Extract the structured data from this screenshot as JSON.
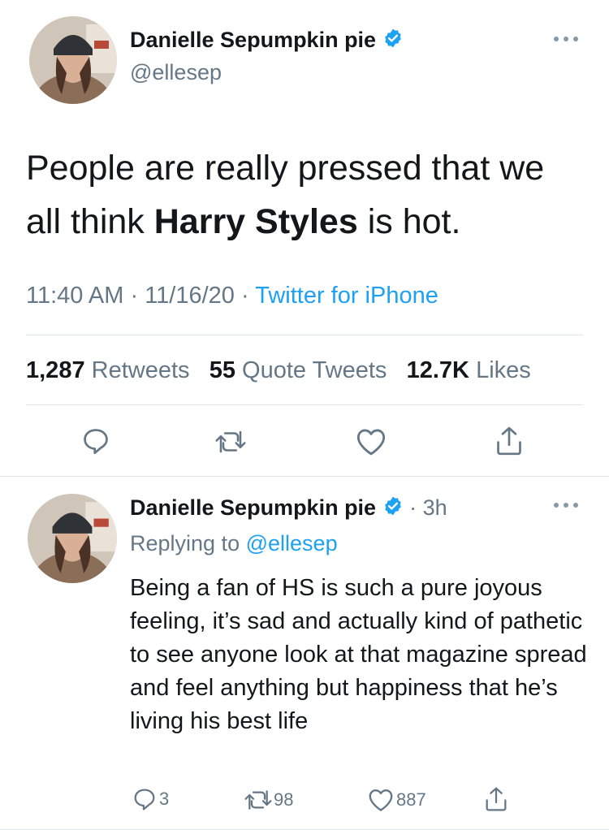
{
  "tweet": {
    "author_name": "Danielle Sepumpkin pie",
    "author_handle": "@ellesep",
    "text_part1": "People are really pressed that we all think ",
    "text_bold": "Harry Styles",
    "text_part2": " is hot.",
    "time": "11:40 AM",
    "date": "11/16/20",
    "separator": "·",
    "source": "Twitter for iPhone",
    "retweets_count": "1,287",
    "retweets_label": "Retweets",
    "quotes_count": "55",
    "quotes_label": "Quote Tweets",
    "likes_count": "12.7K",
    "likes_label": "Likes"
  },
  "reply": {
    "author_name": "Danielle Sepumpkin pie",
    "dot": "·",
    "age": "3h",
    "replying_prefix": "Replying to",
    "replying_handle": "@ellesep",
    "text": "Being a fan of HS is such a pure joyous feeling, it’s sad and actually kind of pathetic to see anyone look at that magazine spread and feel anything but happiness that he’s living his best life",
    "reply_count": "3",
    "retweet_count": "98",
    "like_count": "887"
  },
  "icons": {
    "verified": "verified-badge-icon",
    "more": "more-icon",
    "reply": "reply-icon",
    "retweet": "retweet-icon",
    "like": "heart-icon",
    "share": "share-icon"
  },
  "colors": {
    "link": "#1da1f2",
    "secondary": "#657786",
    "divider": "#e1e8ed"
  }
}
